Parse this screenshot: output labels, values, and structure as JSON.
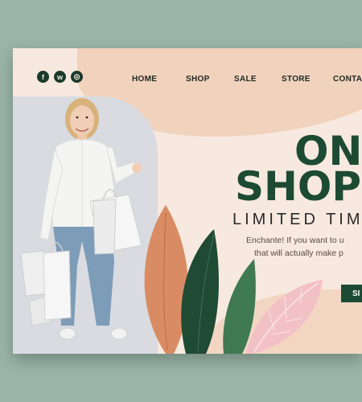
{
  "social": {
    "icons": [
      "facebook-icon",
      "whatsapp-icon",
      "instagram-icon"
    ],
    "facebook_glyph": "f",
    "whatsapp_glyph": "w",
    "instagram_glyph": "◎"
  },
  "nav": {
    "items": [
      {
        "label": "HOME"
      },
      {
        "label": "SHOP"
      },
      {
        "label": "SALE"
      },
      {
        "label": "STORE"
      },
      {
        "label": "CONTA"
      }
    ]
  },
  "hero": {
    "title_line1": "ON",
    "title_line2": "SHOPP",
    "subtitle": "LIMITED TIM",
    "description_line1": "Enchante! If you want to u",
    "description_line2": "that will actually make p",
    "cta_label": "SI"
  },
  "colors": {
    "background": "#9bb5a8",
    "card": "#f7e9df",
    "accent_dark_green": "#1d4a33",
    "peach": "#f1d2bd",
    "leaf_orange": "#d98c63",
    "leaf_green": "#2b5a3c",
    "leaf_pink": "#f2c1c6"
  }
}
